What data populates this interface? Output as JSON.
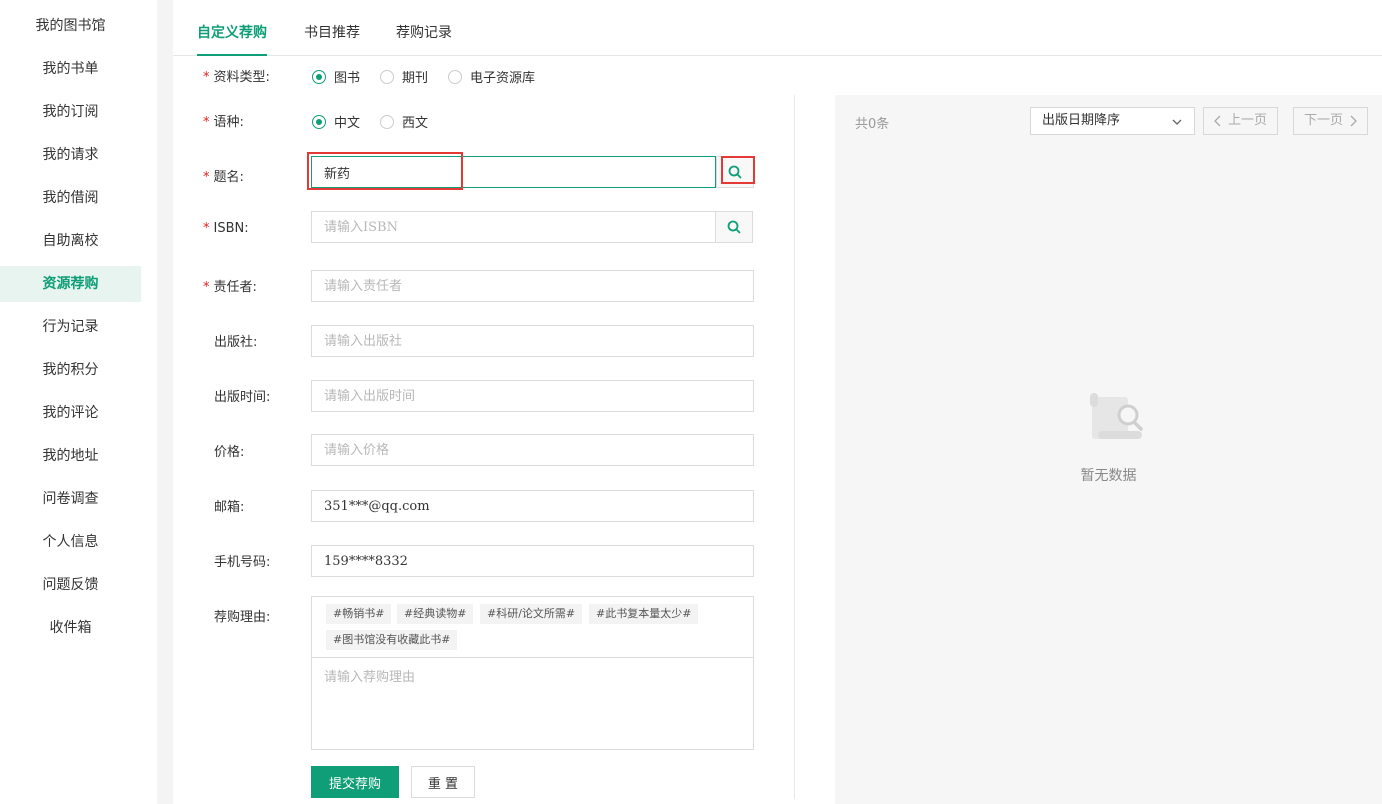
{
  "sidebar": {
    "items": [
      {
        "label": "我的图书馆"
      },
      {
        "label": "我的书单"
      },
      {
        "label": "我的订阅"
      },
      {
        "label": "我的请求"
      },
      {
        "label": "我的借阅"
      },
      {
        "label": "自助离校"
      },
      {
        "label": "资源荐购",
        "active": true
      },
      {
        "label": "行为记录"
      },
      {
        "label": "我的积分"
      },
      {
        "label": "我的评论"
      },
      {
        "label": "我的地址"
      },
      {
        "label": "问卷调查"
      },
      {
        "label": "个人信息"
      },
      {
        "label": "问题反馈"
      },
      {
        "label": "收件箱"
      }
    ]
  },
  "tabs": [
    {
      "label": "自定义荐购",
      "active": true
    },
    {
      "label": "书目推荐"
    },
    {
      "label": "荐购记录"
    }
  ],
  "form": {
    "type": {
      "label": "资料类型",
      "options": [
        "图书",
        "期刊",
        "电子资源库"
      ],
      "selected": "图书"
    },
    "language": {
      "label": "语种",
      "options": [
        "中文",
        "西文"
      ],
      "selected": "中文"
    },
    "title": {
      "label": "题名",
      "value": "新药"
    },
    "isbn": {
      "label": "ISBN",
      "placeholder": "请输入ISBN"
    },
    "author": {
      "label": "责任者",
      "placeholder": "请输入责任者"
    },
    "publisher": {
      "label": "出版社",
      "placeholder": "请输入出版社"
    },
    "pubdate": {
      "label": "出版时间",
      "placeholder": "请输入出版时间"
    },
    "price": {
      "label": "价格",
      "placeholder": "请输入价格"
    },
    "email": {
      "label": "邮箱",
      "value": "351***@qq.com"
    },
    "phone": {
      "label": "手机号码",
      "value": "159****8332"
    },
    "reason": {
      "label": "荐购理由",
      "tags": [
        "#畅销书#",
        "#经典读物#",
        "#科研/论文所需#",
        "#此书复本量太少#",
        "#图书馆没有收藏此书#"
      ],
      "placeholder": "请输入荐购理由"
    },
    "submit_label": "提交荐购",
    "reset_label": "重 置",
    "colon": ":"
  },
  "results": {
    "count_text": "共0条",
    "sort_selected": "出版日期降序",
    "prev_label": "上一页",
    "next_label": "下一页",
    "empty_text": "暂无数据"
  },
  "colors": {
    "accent": "#0f9e77",
    "required": "#e02020",
    "highlight": "#e53935"
  }
}
